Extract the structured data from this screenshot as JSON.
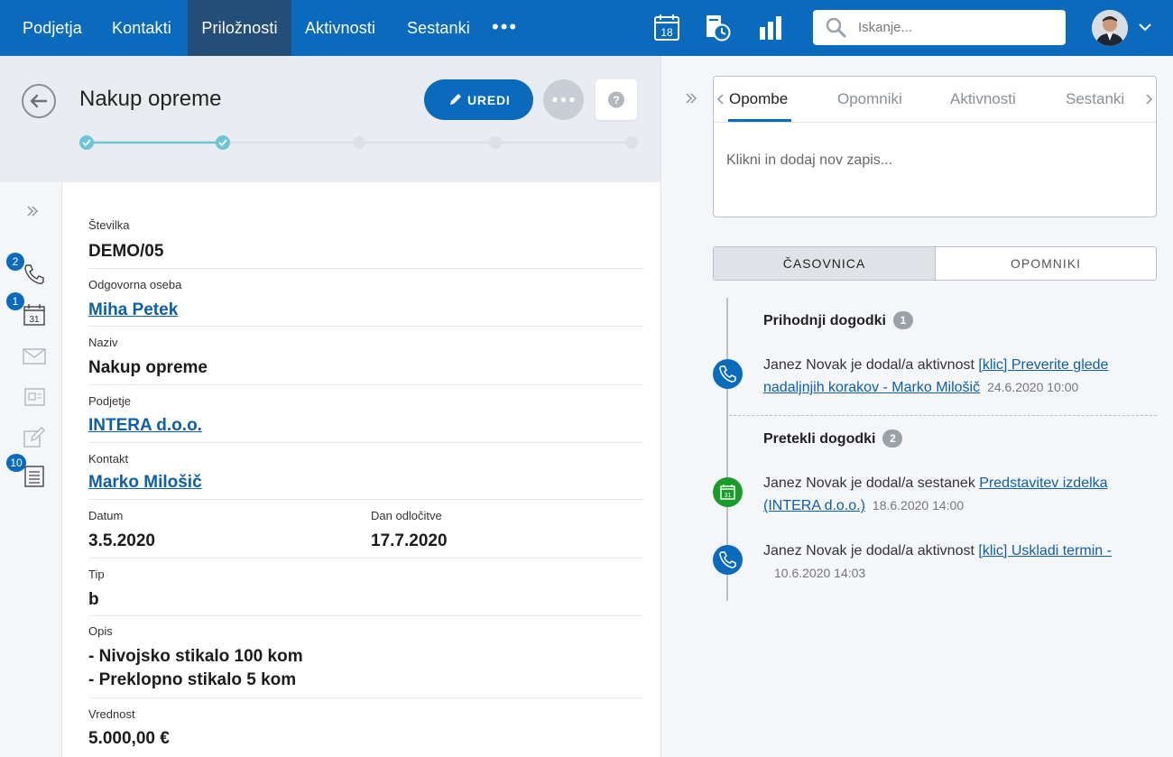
{
  "nav": {
    "items": [
      {
        "label": "Podjetja",
        "active": false
      },
      {
        "label": "Kontakti",
        "active": false
      },
      {
        "label": "Priložnosti",
        "active": true
      },
      {
        "label": "Aktivnosti",
        "active": false
      },
      {
        "label": "Sestanki",
        "active": false
      }
    ],
    "more": "•••",
    "calendar_day": "18",
    "search_placeholder": "Iskanje..."
  },
  "header": {
    "title": "Nakup opreme",
    "edit_label": "UREDI",
    "progress": {
      "total_steps": 5,
      "completed_steps": 2
    }
  },
  "sidebar": {
    "badges": {
      "calls": "2",
      "meetings": "1",
      "notes": "10"
    },
    "calendar_day": "31"
  },
  "form": {
    "number": {
      "label": "Številka",
      "value": "DEMO/05"
    },
    "owner": {
      "label": "Odgovorna oseba",
      "value": "Miha Petek"
    },
    "name": {
      "label": "Naziv",
      "value": "Nakup opreme"
    },
    "company": {
      "label": "Podjetje",
      "value": "INTERA d.o.o."
    },
    "contact": {
      "label": "Kontakt",
      "value": "Marko Milošič"
    },
    "date": {
      "label": "Datum",
      "value": "3.5.2020"
    },
    "decision": {
      "label": "Dan odločitve",
      "value": "17.7.2020"
    },
    "type": {
      "label": "Tip",
      "value": "b"
    },
    "description": {
      "label": "Opis",
      "line1": "- Nivojsko stikalo 100 kom",
      "line2": "- Preklopno stikalo 5 kom"
    },
    "amount": {
      "label": "Vrednost",
      "value": "5.000,00 €"
    }
  },
  "notes": {
    "tabs": [
      "Opombe",
      "Opomniki",
      "Aktivnosti",
      "Sestanki"
    ],
    "placeholder": "Klikni in dodaj nov zapis..."
  },
  "timeline": {
    "tabs": [
      "ČASOVNICA",
      "OPOMNIKI"
    ],
    "upcoming": {
      "title": "Prihodnji dogodki",
      "count": "1",
      "events": [
        {
          "text": "Janez Novak je dodal/a aktivnost",
          "link": "[klic] Preverite glede nadaljnjih korakov - Marko Milošič",
          "time": "24.6.2020 10:00",
          "kind": "call"
        }
      ]
    },
    "past": {
      "title": "Pretekli dogodki",
      "count": "2",
      "events": [
        {
          "text": "Janez Novak je dodal/a sestanek",
          "link": "Predstavitev izdelka (INTERA d.o.o.)",
          "time": "18.6.2020 14:00",
          "kind": "meeting"
        },
        {
          "text": "Janez Novak je dodal/a aktivnost",
          "link": "[klic] Uskladi termin -",
          "time": "10.6.2020 14:03",
          "kind": "call"
        }
      ]
    }
  },
  "colors": {
    "primary": "#0a6bbd",
    "nav_active": "#234e78",
    "progress": "#6cc5d6",
    "meeting_green": "#1a9b2a",
    "link": "#0d5fa8"
  }
}
